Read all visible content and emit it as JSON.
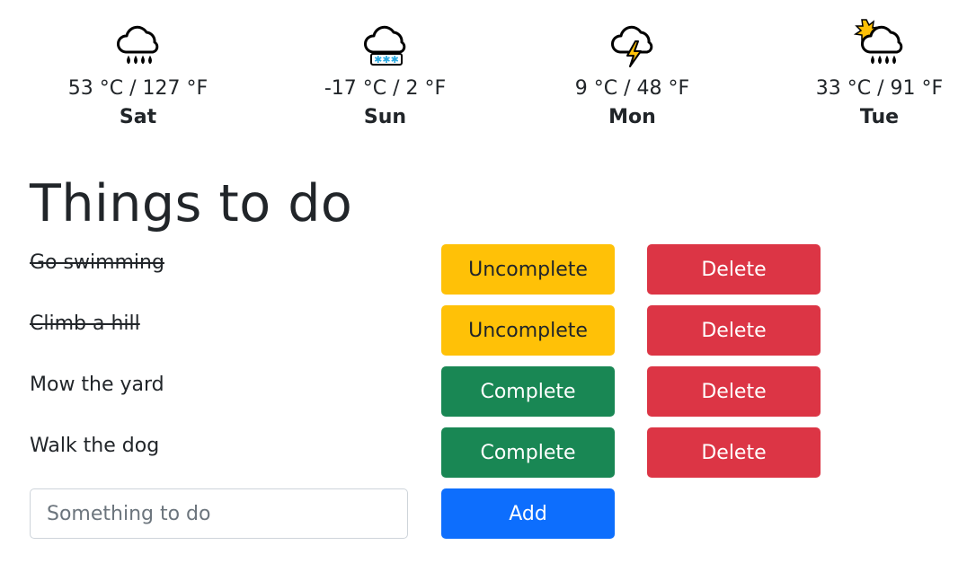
{
  "weather": [
    {
      "icon": "rain-cloud-icon",
      "temp": "53 °C / 127 °F",
      "day": "Sat"
    },
    {
      "icon": "snow-cloud-icon",
      "temp": "-17 °C / 2 °F",
      "day": "Sun"
    },
    {
      "icon": "thunderstorm-icon",
      "temp": "9 °C / 48 °F",
      "day": "Mon"
    },
    {
      "icon": "sun-rain-cloud-icon",
      "temp": "33 °C / 91 °F",
      "day": "Tue"
    }
  ],
  "todo": {
    "title": "Things to do",
    "items": [
      {
        "text": "Go swimming",
        "completed": true,
        "toggle_label": "Uncomplete",
        "delete_label": "Delete"
      },
      {
        "text": "Climb a hill",
        "completed": true,
        "toggle_label": "Uncomplete",
        "delete_label": "Delete"
      },
      {
        "text": "Mow the yard",
        "completed": false,
        "toggle_label": "Complete",
        "delete_label": "Delete"
      },
      {
        "text": "Walk the dog",
        "completed": false,
        "toggle_label": "Complete",
        "delete_label": "Delete"
      }
    ],
    "new_item": {
      "value": "",
      "placeholder": "Something to do"
    },
    "add_label": "Add"
  },
  "colors": {
    "uncomplete": "#ffc107",
    "complete": "#198754",
    "delete": "#dc3545",
    "add": "#0d6efd"
  }
}
